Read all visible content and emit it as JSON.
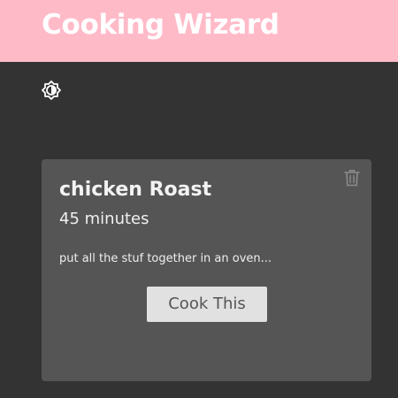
{
  "header": {
    "title": "Cooking Wizard",
    "background_color": "#ffbac8"
  },
  "theme_toggle": {
    "icon": "brightness-contrast-icon"
  },
  "recipe": {
    "name": "chicken Roast",
    "time": "45 minutes",
    "description": "put all the stuf together in an oven...",
    "cook_label": "Cook This",
    "delete_icon": "trash-icon"
  },
  "colors": {
    "page_background": "#333333",
    "card_background": "#555555",
    "button_background": "#e1e1e1"
  }
}
